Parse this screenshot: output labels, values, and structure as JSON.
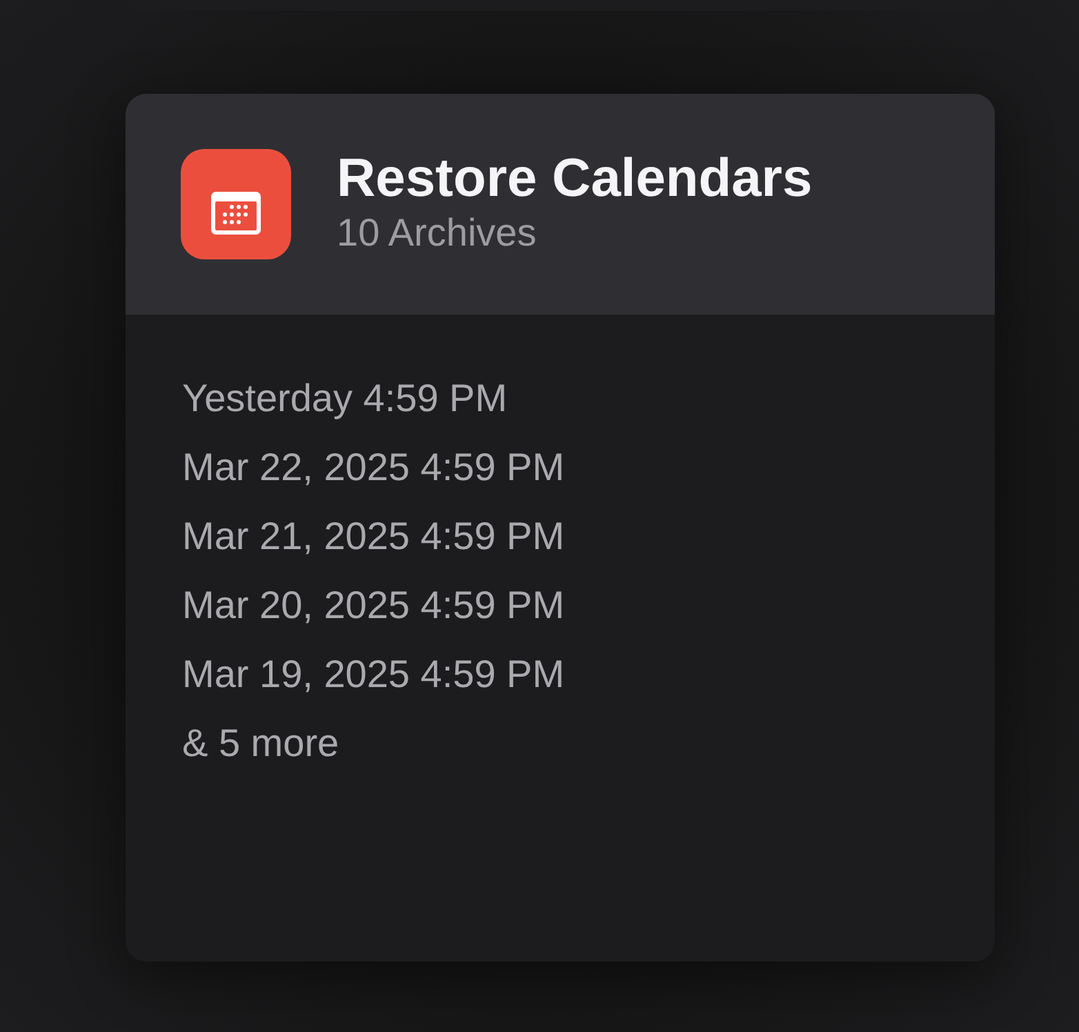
{
  "card": {
    "title": "Restore Calendars",
    "subtitle": "10 Archives",
    "archives": [
      "Yesterday 4:59 PM",
      "Mar 22, 2025 4:59 PM",
      "Mar 21, 2025 4:59 PM",
      "Mar 20, 2025 4:59 PM",
      "Mar 19, 2025 4:59 PM"
    ],
    "more": "& 5 more"
  }
}
